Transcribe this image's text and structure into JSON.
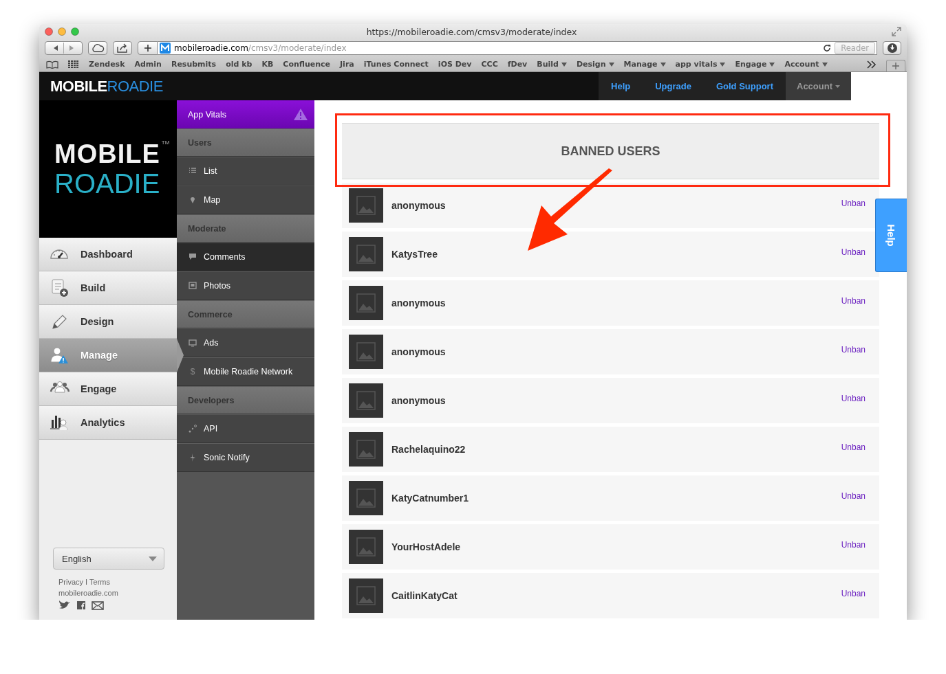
{
  "browser": {
    "title": "https://mobileroadie.com/cmsv3/moderate/index",
    "address": {
      "domain": "mobileroadie.com",
      "path": "/cmsv3/moderate/index"
    },
    "reader": "Reader",
    "bookmarks": [
      {
        "label": "Zendesk",
        "menu": false
      },
      {
        "label": "Admin",
        "menu": false
      },
      {
        "label": "Resubmits",
        "menu": false
      },
      {
        "label": "old kb",
        "menu": false
      },
      {
        "label": "KB",
        "menu": false
      },
      {
        "label": "Confluence",
        "menu": false
      },
      {
        "label": "Jira",
        "menu": false
      },
      {
        "label": "iTunes Connect",
        "menu": false
      },
      {
        "label": "iOS Dev",
        "menu": false
      },
      {
        "label": "CCC",
        "menu": false
      },
      {
        "label": "fDev",
        "menu": false
      },
      {
        "label": "Build",
        "menu": true
      },
      {
        "label": "Design",
        "menu": true
      },
      {
        "label": "Manage",
        "menu": true
      },
      {
        "label": "app vitals",
        "menu": true
      },
      {
        "label": "Engage",
        "menu": true
      },
      {
        "label": "Account",
        "menu": true
      }
    ]
  },
  "header": {
    "logo": {
      "first": "MOBILE",
      "second": "ROADIE"
    },
    "nav": [
      {
        "label": "Help",
        "kind": "link"
      },
      {
        "label": "Upgrade",
        "kind": "link"
      },
      {
        "label": "Gold Support",
        "kind": "link"
      },
      {
        "label": "Account",
        "kind": "menu"
      }
    ]
  },
  "sidebar": {
    "logo": {
      "first": "MOBILE",
      "second": "ROADIE",
      "mark": "TM"
    },
    "items": [
      {
        "label": "Dashboard",
        "selected": false
      },
      {
        "label": "Build",
        "selected": false
      },
      {
        "label": "Design",
        "selected": false
      },
      {
        "label": "Manage",
        "selected": true
      },
      {
        "label": "Engage",
        "selected": false
      },
      {
        "label": "Analytics",
        "selected": false
      }
    ],
    "language": "English",
    "legal": "Privacy I Terms",
    "site": "mobileroadie.com"
  },
  "submenu": [
    {
      "kind": "accent",
      "label": "App Vitals",
      "selected": false
    },
    {
      "kind": "header",
      "label": "Users",
      "selected": false
    },
    {
      "kind": "item",
      "label": "List",
      "selected": false
    },
    {
      "kind": "item",
      "label": "Map",
      "selected": false
    },
    {
      "kind": "header",
      "label": "Moderate",
      "selected": false
    },
    {
      "kind": "item",
      "label": "Comments",
      "selected": true
    },
    {
      "kind": "item",
      "label": "Photos",
      "selected": false
    },
    {
      "kind": "header",
      "label": "Commerce",
      "selected": false
    },
    {
      "kind": "item",
      "label": "Ads",
      "selected": false
    },
    {
      "kind": "item",
      "label": "Mobile Roadie Network",
      "selected": false,
      "glyph": "$"
    },
    {
      "kind": "header",
      "label": "Developers",
      "selected": false
    },
    {
      "kind": "item",
      "label": "API",
      "selected": false
    },
    {
      "kind": "item",
      "label": "Sonic Notify",
      "selected": false
    }
  ],
  "main": {
    "title": "BANNED USERS",
    "help_tab": "Help",
    "users": [
      {
        "name": "anonymous",
        "action": "Unban"
      },
      {
        "name": "KatysTree",
        "action": "Unban"
      },
      {
        "name": "anonymous",
        "action": "Unban"
      },
      {
        "name": "anonymous",
        "action": "Unban"
      },
      {
        "name": "anonymous",
        "action": "Unban"
      },
      {
        "name": "Rachelaquino22",
        "action": "Unban"
      },
      {
        "name": "KatyCatnumber1",
        "action": "Unban"
      },
      {
        "name": "YourHostAdele",
        "action": "Unban"
      },
      {
        "name": "CaitlinKatyCat",
        "action": "Unban"
      }
    ]
  }
}
